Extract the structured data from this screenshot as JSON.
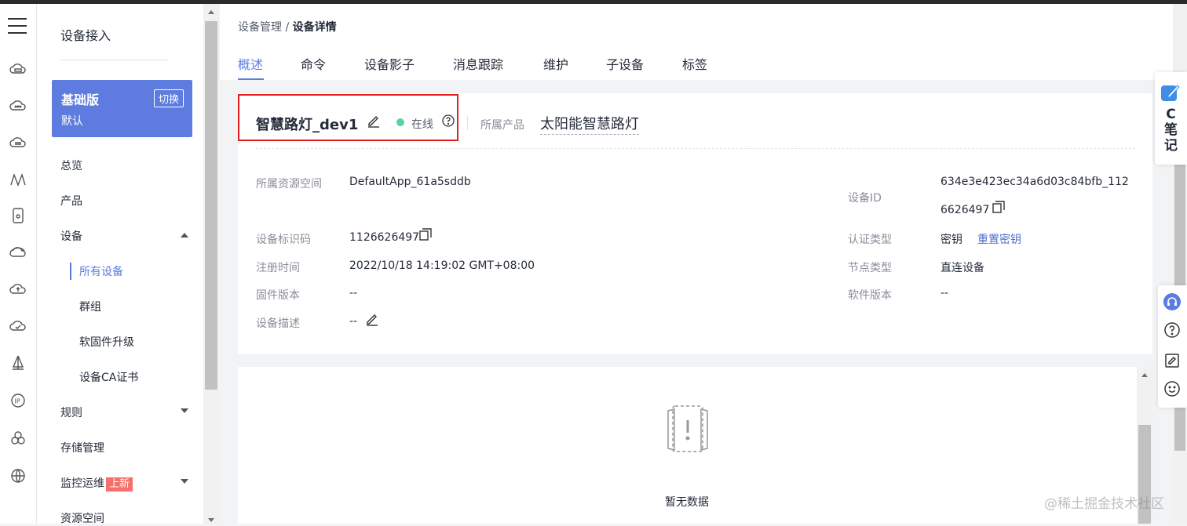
{
  "rail": {
    "icons": [
      "cloud-box-icon",
      "cloud-dots-icon",
      "cloud-db-icon",
      "mountain-icon",
      "phone-icon",
      "cloud-ring-icon",
      "cloud-upload-icon",
      "cloud-check-icon",
      "sail-icon",
      "ip-icon",
      "cluster-icon",
      "globe-w-icon"
    ]
  },
  "sidebar": {
    "title": "设备接入",
    "edition": {
      "name": "基础版",
      "sub": "默认",
      "switch_label": "切换"
    },
    "items": {
      "overview": "总览",
      "product": "产品",
      "device": "设备",
      "all_devices": "所有设备",
      "groups": "群组",
      "firmware": "软固件升级",
      "ca_cert": "设备CA证书",
      "rules": "规则",
      "storage": "存储管理",
      "monitor": "监控运维",
      "monitor_badge": "上新",
      "resource": "资源空间"
    }
  },
  "breadcrumb": {
    "parent": "设备管理",
    "separator": " / ",
    "current": "设备详情"
  },
  "tabs": [
    "概述",
    "命令",
    "设备影子",
    "消息跟踪",
    "维护",
    "子设备",
    "标签"
  ],
  "device": {
    "name": "智慧路灯_dev1",
    "status": "在线",
    "product_label": "所属产品",
    "product_value": "太阳能智慧路灯"
  },
  "fields": {
    "resource_space_label": "所属资源空间",
    "resource_space_value": "DefaultApp_61a5sddb",
    "device_id_label": "设备ID",
    "device_id_line1": "634e3e423ec34a6d03c84bfb_112",
    "device_id_line2": "6626497",
    "identifier_label": "设备标识码",
    "identifier_value": "1126626497",
    "auth_label": "认证类型",
    "auth_value": "密钥",
    "auth_link": "重置密钥",
    "reg_time_label": "注册时间",
    "reg_time_value": "2022/10/18 14:19:02 GMT+08:00",
    "node_type_label": "节点类型",
    "node_type_value": "直连设备",
    "firmware_label": "固件版本",
    "firmware_value": "--",
    "software_label": "软件版本",
    "software_value": "--",
    "desc_label": "设备描述",
    "desc_value": "--"
  },
  "empty": {
    "text": "暂无数据"
  },
  "floating": {
    "note_text": "C笔记"
  },
  "watermark": "@稀土掘金技术社区",
  "colors": {
    "accent": "#5e7ce0",
    "online": "#5dd0a8",
    "highlight": "#e11d1d",
    "badge": "#f66f6a"
  }
}
